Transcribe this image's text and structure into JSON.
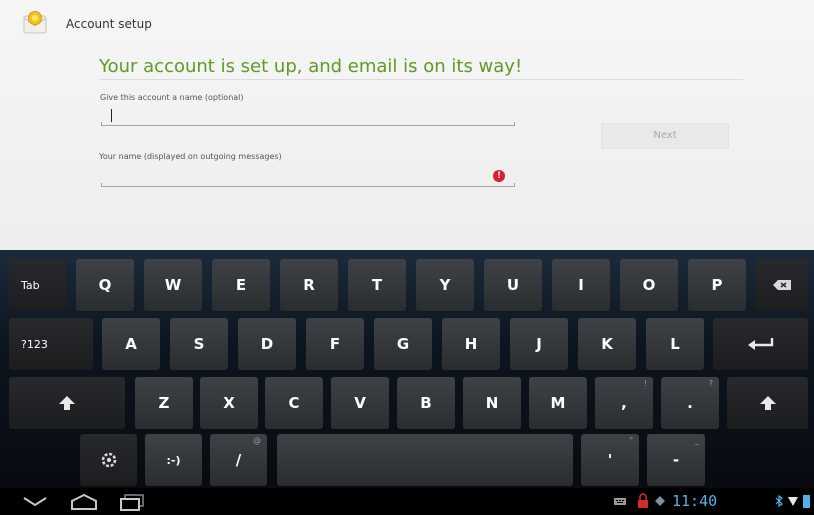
{
  "header": {
    "title": "Account setup",
    "icon": "email-app-icon"
  },
  "main": {
    "headline": "Your account is set up, and email is on its way!",
    "account_name": {
      "label": "Give this account a name (optional)",
      "value": ""
    },
    "your_name": {
      "label": "Your name (displayed on outgoing messages)",
      "value": "",
      "error_glyph": "!"
    },
    "next_label": "Next"
  },
  "keyboard": {
    "row1": {
      "tab": "Tab",
      "letters": [
        "Q",
        "W",
        "E",
        "R",
        "T",
        "Y",
        "U",
        "I",
        "O",
        "P"
      ]
    },
    "row2": {
      "sym": "?123",
      "letters": [
        "A",
        "S",
        "D",
        "F",
        "G",
        "H",
        "J",
        "K",
        "L"
      ]
    },
    "row3": {
      "letters": [
        "Z",
        "X",
        "C",
        "V",
        "B",
        "N",
        "M"
      ],
      "comma": ",",
      "comma_alt": "!",
      "period": ".",
      "period_alt": "?"
    },
    "row4": {
      "smiley": ":-)",
      "slash": "/",
      "slash_alt": "@",
      "apos": "'",
      "apos_alt": "\"",
      "dash": "-",
      "dash_alt": "_"
    }
  },
  "status_bar": {
    "clock": "11:40"
  },
  "colors": {
    "accent": "#5f9a23",
    "error": "#e01b2b",
    "clock": "#4fb3e8"
  }
}
